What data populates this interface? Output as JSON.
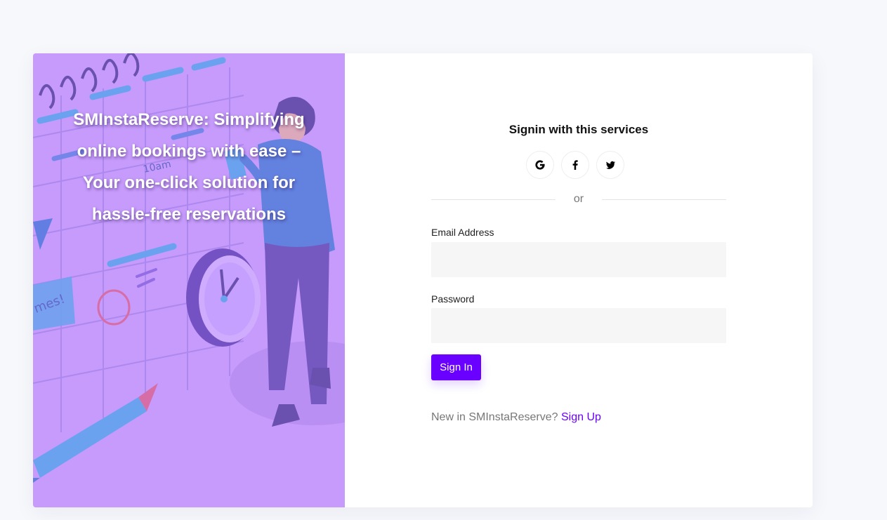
{
  "hero": {
    "tagline": "SMInstaReserve: Simplifying online bookings with ease – Your one-click solution for hassle-free reservations"
  },
  "signin": {
    "services_title": "Signin with this services",
    "social": [
      {
        "name": "google",
        "icon": "google-icon"
      },
      {
        "name": "facebook",
        "icon": "facebook-icon"
      },
      {
        "name": "twitter",
        "icon": "twitter-icon"
      }
    ],
    "divider_text": "or",
    "email": {
      "label": "Email Address",
      "value": "",
      "placeholder": ""
    },
    "password": {
      "label": "Password",
      "value": "",
      "placeholder": ""
    },
    "submit_label": "Sign In",
    "signup_prompt": "New in SMInstaReserve?",
    "signup_link": "Sign Up"
  },
  "colors": {
    "accent": "#6a00ff",
    "hero_bg": "#c79bfb",
    "page_bg": "#f7f8fc",
    "input_bg": "#f6f6f6"
  }
}
